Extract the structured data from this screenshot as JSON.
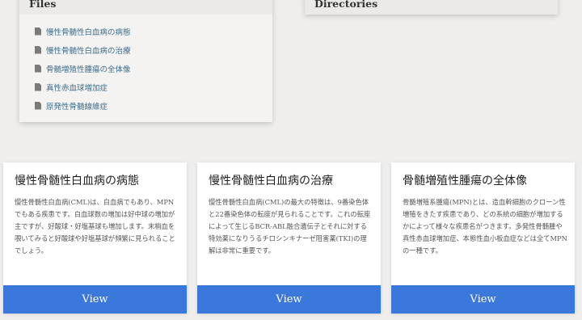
{
  "files": {
    "heading": "Files",
    "items": [
      {
        "label": "慢性骨髄性白血病の病態"
      },
      {
        "label": "慢性骨髄性白血病の治療"
      },
      {
        "label": "骨髄増殖性腫瘍の全体像"
      },
      {
        "label": "真性赤血球増加症"
      },
      {
        "label": "原発性骨髄線維症"
      }
    ]
  },
  "directories": {
    "heading": "Directories"
  },
  "cards": [
    {
      "title": "慢性骨髄性白血病の病態",
      "text": "慢性骨髄性白血病(CML)は、白血病でもあり、MPNでもある疾患です。白血球数の増加は好中球の増加が主ですが、好酸球・好塩基球も増加します。末梢血を覗いてみると好酸球や好塩基球が頻繁に見られることでしょう。",
      "button": "View"
    },
    {
      "title": "慢性骨髄性白血病の治療",
      "text": "慢性骨髄性白血病(CML)の最大の特徴は、9番染色体と22番染色体の転座が見られることです。これの転座によって生じるBCR-ABL融合遺伝子とそれに対する特効薬になりうるチロシンキナーゼ阻害薬(TKI)の理解は非常に重要です。",
      "button": "View"
    },
    {
      "title": "骨髄増殖性腫瘍の全体像",
      "text": "骨髄増殖系腫瘍(MPN)とは、造血幹細胞のクローン性増殖をきたす疾患であり、どの系統の細胞が増加するかによって様々な疾患名がつきます。多発性骨髄腫や真性赤血球増加症、本態性血小板血症などは全てMPNの一種です。",
      "button": "View"
    }
  ]
}
